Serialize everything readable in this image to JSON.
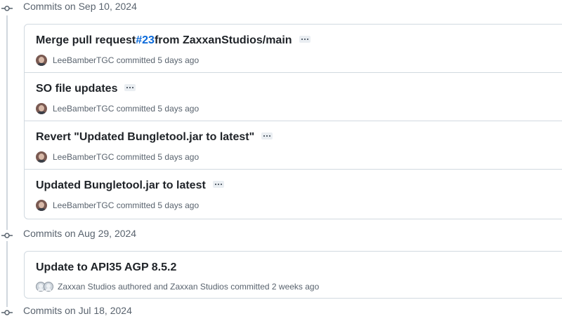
{
  "groups": [
    {
      "label": "Commits on Sep 10, 2024",
      "commits": [
        {
          "title_prefix": "Merge pull request ",
          "pr": "#23",
          "title_suffix": " from ZaxxanStudios/main",
          "author": "LeeBamberTGC",
          "action": "committed",
          "time": "5 days ago"
        },
        {
          "title": "SO file updates",
          "author": "LeeBamberTGC",
          "action": "committed",
          "time": "5 days ago"
        },
        {
          "title": "Revert \"Updated Bungletool.jar to latest\"",
          "author": "LeeBamberTGC",
          "action": "committed",
          "time": "5 days ago"
        },
        {
          "title": "Updated Bungletool.jar to latest",
          "author": "LeeBamberTGC",
          "action": "committed",
          "time": "5 days ago"
        }
      ]
    },
    {
      "label": "Commits on Aug 29, 2024",
      "commits": [
        {
          "title": "Update to API35 AGP 8.5.2",
          "author": "Zaxxan Studios",
          "action": "authored and",
          "committer": "Zaxxan Studios",
          "action2": "committed",
          "time": "2 weeks ago"
        }
      ]
    },
    {
      "label": "Commits on Jul 18, 2024"
    }
  ],
  "icons": {
    "commit": "git-commit-icon",
    "more": "ellipsis-icon",
    "avatar": "user-avatar"
  },
  "colors": {
    "link": "#0969da",
    "muted": "#59636e",
    "border": "#d1d9e0"
  }
}
